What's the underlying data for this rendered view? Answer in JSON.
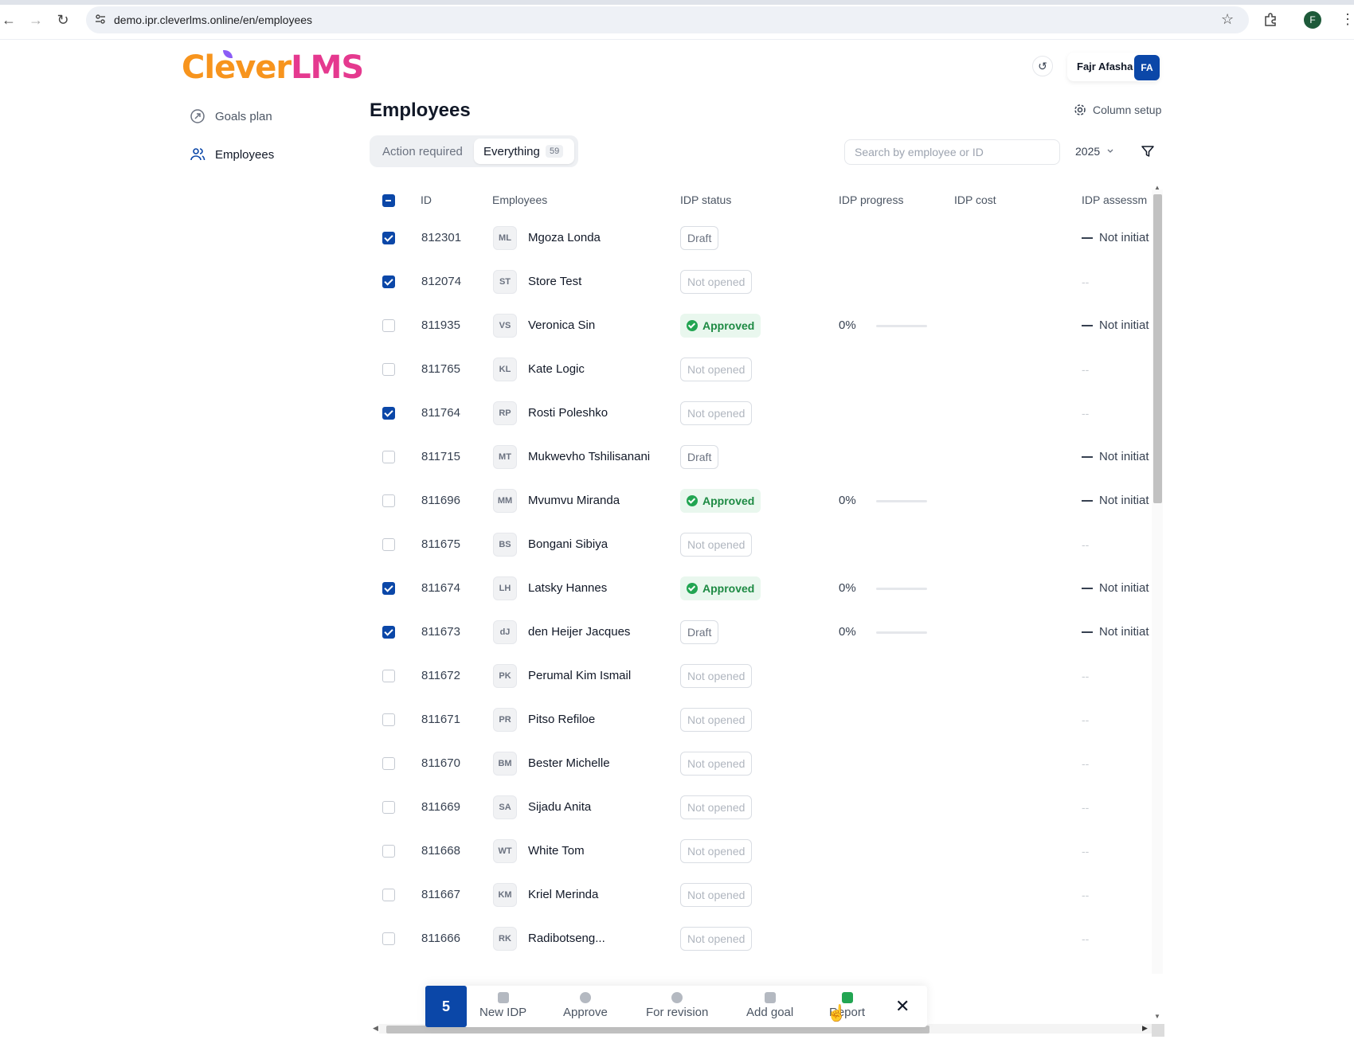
{
  "browser": {
    "url": "demo.ipr.cleverlms.online/en/employees",
    "profile_initial": "F"
  },
  "app": {
    "logo_part1": "Clever",
    "logo_part2": "LMS",
    "user_name": "Fajr Afasha",
    "user_initials": "FA"
  },
  "sidebar": {
    "items": [
      {
        "label": "Goals plan",
        "icon": "goals-icon"
      },
      {
        "label": "Employees",
        "icon": "users-icon"
      }
    ]
  },
  "page": {
    "title": "Employees",
    "column_setup": "Column setup",
    "tabs": [
      {
        "label": "Action required"
      },
      {
        "label": "Everything",
        "count": "59"
      }
    ],
    "search_placeholder": "Search by employee or ID",
    "year": "2025"
  },
  "table": {
    "headers": {
      "id": "ID",
      "employees": "Employees",
      "idp_status": "IDP status",
      "idp_progress": "IDP progress",
      "idp_cost": "IDP cost",
      "idp_assessment": "IDP assessm"
    },
    "rows": [
      {
        "checked": true,
        "id": "812301",
        "initials": "ML",
        "name": "Mgoza Londa",
        "status": "Draft",
        "status_type": "draft",
        "progress": "",
        "assessment": "Not initiat"
      },
      {
        "checked": true,
        "id": "812074",
        "initials": "ST",
        "name": "Store Test",
        "status": "Not opened",
        "status_type": "notopened",
        "progress": "",
        "assessment": "--"
      },
      {
        "checked": false,
        "id": "811935",
        "initials": "VS",
        "name": "Veronica Sin",
        "status": "Approved",
        "status_type": "approved",
        "progress": "0%",
        "assessment": "Not initiat"
      },
      {
        "checked": false,
        "id": "811765",
        "initials": "KL",
        "name": "Kate Logic",
        "status": "Not opened",
        "status_type": "notopened",
        "progress": "",
        "assessment": "--"
      },
      {
        "checked": true,
        "id": "811764",
        "initials": "RP",
        "name": "Rosti Poleshko",
        "status": "Not opened",
        "status_type": "notopened",
        "progress": "",
        "assessment": "--"
      },
      {
        "checked": false,
        "id": "811715",
        "initials": "MT",
        "name": "Mukwevho Tshilisanani",
        "status": "Draft",
        "status_type": "draft",
        "progress": "",
        "assessment": "Not initiat"
      },
      {
        "checked": false,
        "id": "811696",
        "initials": "MM",
        "name": "Mvumvu Miranda",
        "status": "Approved",
        "status_type": "approved",
        "progress": "0%",
        "assessment": "Not initiat"
      },
      {
        "checked": false,
        "id": "811675",
        "initials": "BS",
        "name": "Bongani Sibiya",
        "status": "Not opened",
        "status_type": "notopened",
        "progress": "",
        "assessment": "--"
      },
      {
        "checked": true,
        "id": "811674",
        "initials": "LH",
        "name": "Latsky Hannes",
        "status": "Approved",
        "status_type": "approved",
        "progress": "0%",
        "assessment": "Not initiat"
      },
      {
        "checked": true,
        "id": "811673",
        "initials": "dJ",
        "name": "den Heijer Jacques",
        "status": "Draft",
        "status_type": "draft",
        "progress": "0%",
        "assessment": "Not initiat"
      },
      {
        "checked": false,
        "id": "811672",
        "initials": "PK",
        "name": "Perumal Kim Ismail",
        "status": "Not opened",
        "status_type": "notopened",
        "progress": "",
        "assessment": "--"
      },
      {
        "checked": false,
        "id": "811671",
        "initials": "PR",
        "name": "Pitso Refiloe",
        "status": "Not opened",
        "status_type": "notopened",
        "progress": "",
        "assessment": "--"
      },
      {
        "checked": false,
        "id": "811670",
        "initials": "BM",
        "name": "Bester Michelle",
        "status": "Not opened",
        "status_type": "notopened",
        "progress": "",
        "assessment": "--"
      },
      {
        "checked": false,
        "id": "811669",
        "initials": "SA",
        "name": "Sijadu Anita",
        "status": "Not opened",
        "status_type": "notopened",
        "progress": "",
        "assessment": "--"
      },
      {
        "checked": false,
        "id": "811668",
        "initials": "WT",
        "name": "White Tom",
        "status": "Not opened",
        "status_type": "notopened",
        "progress": "",
        "assessment": "--"
      },
      {
        "checked": false,
        "id": "811667",
        "initials": "KM",
        "name": "Kriel Merinda",
        "status": "Not opened",
        "status_type": "notopened",
        "progress": "",
        "assessment": "--"
      },
      {
        "checked": false,
        "id": "811666",
        "initials": "RK",
        "name": "Radibotseng...",
        "status": "Not opened",
        "status_type": "notopened",
        "progress": "",
        "assessment": "--"
      }
    ]
  },
  "action_bar": {
    "selected_count": "5",
    "actions": [
      {
        "label": "New IDP",
        "icon": "new-idp-icon"
      },
      {
        "label": "Approve",
        "icon": "approve-icon"
      },
      {
        "label": "For revision",
        "icon": "revision-icon"
      },
      {
        "label": "Add goal",
        "icon": "add-goal-icon"
      },
      {
        "label": "Report",
        "icon": "report-icon"
      }
    ]
  },
  "colors": {
    "accent": "#0b47a8",
    "approved_text": "#1d8a43",
    "approved_bg": "#e9f7ee"
  }
}
